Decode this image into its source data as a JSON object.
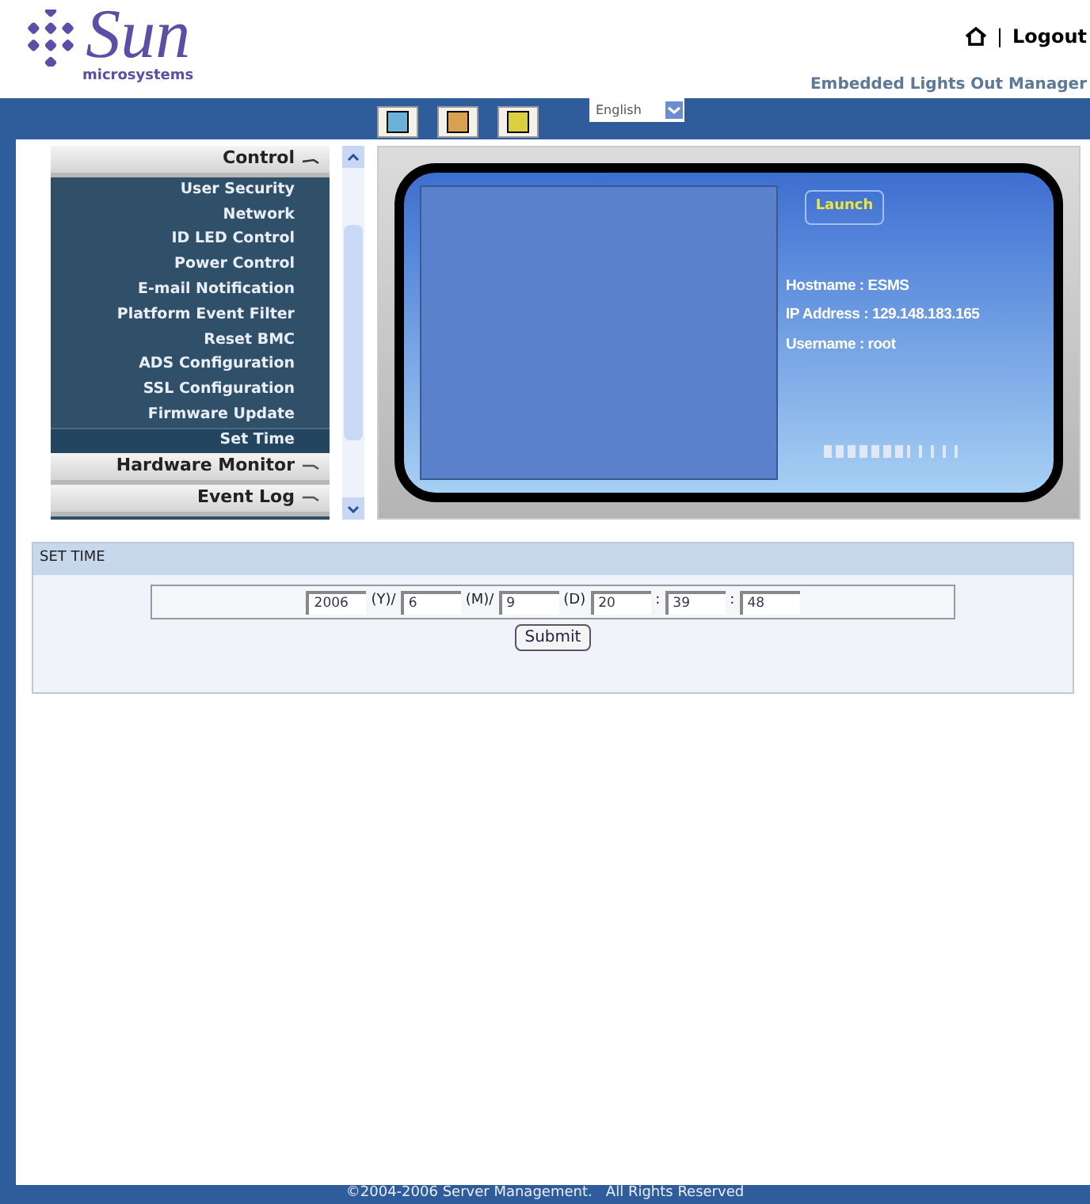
{
  "header": {
    "logo_text": "Sun",
    "logo_subtext": "microsystems",
    "separator": "|",
    "logout": "Logout",
    "product": "Embedded Lights Out Manager"
  },
  "language": {
    "value": "English"
  },
  "sidebar": {
    "sections": [
      {
        "title": "Control",
        "expanded": true,
        "items": [
          {
            "label": "User Security",
            "selected": false
          },
          {
            "label": "Network",
            "selected": false
          },
          {
            "label": "ID LED Control",
            "selected": false
          },
          {
            "label": "Power Control",
            "selected": false
          },
          {
            "label": "E-mail Notification",
            "selected": false
          },
          {
            "label": "Platform Event Filter",
            "selected": false
          },
          {
            "label": "Reset BMC",
            "selected": false
          },
          {
            "label": "ADS Configuration",
            "selected": false
          },
          {
            "label": "SSL Configuration",
            "selected": false
          },
          {
            "label": "Firmware Update",
            "selected": false
          },
          {
            "label": "Set Time",
            "selected": true
          }
        ]
      },
      {
        "title": "Hardware Monitor",
        "expanded": false
      },
      {
        "title": "Event Log",
        "expanded": false
      }
    ]
  },
  "console": {
    "launch": "Launch",
    "info": [
      "Hostname : ESMS",
      "IP Address : 129.148.183.165",
      "Username : root"
    ]
  },
  "set_time": {
    "title": "SET TIME",
    "fields": [
      {
        "value": "2006",
        "suffix": "(Y)/"
      },
      {
        "value": "6",
        "suffix": "(M)/"
      },
      {
        "value": "9",
        "suffix": "(D)"
      },
      {
        "value": "20",
        "suffix": ":"
      },
      {
        "value": "39",
        "suffix": ":"
      },
      {
        "value": "48"
      }
    ],
    "submit": "Submit"
  },
  "footer": "©2004-2006 Server Management.   All Rights Reserved"
}
